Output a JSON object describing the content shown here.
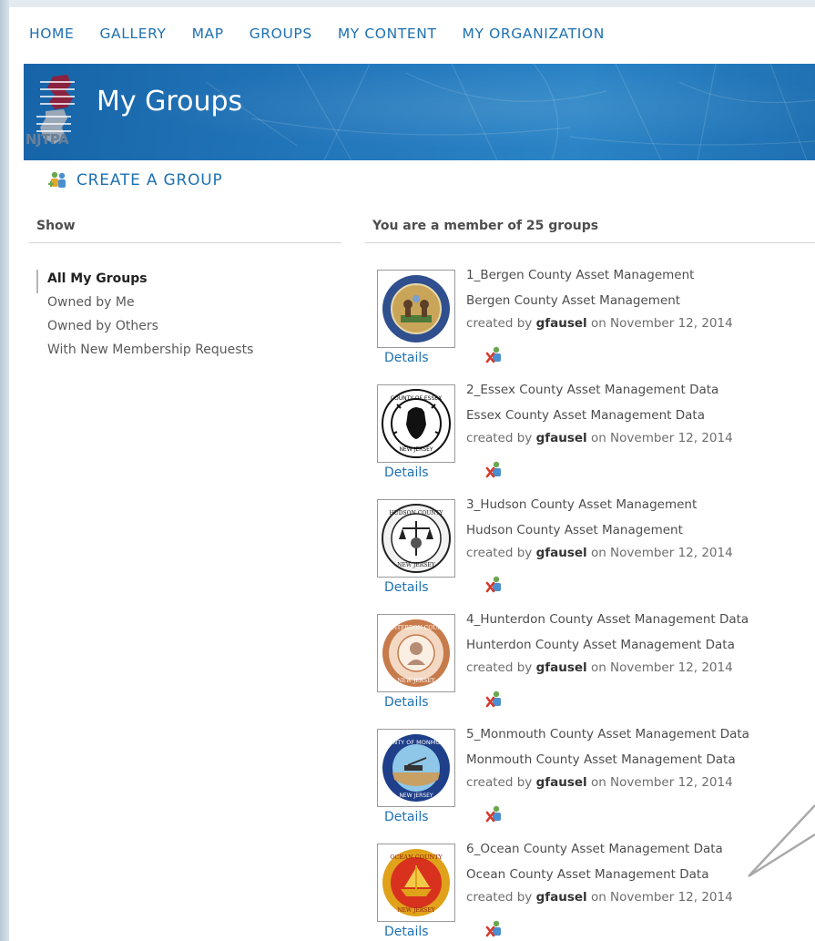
{
  "nav": {
    "items": [
      "HOME",
      "GALLERY",
      "MAP",
      "GROUPS",
      "MY CONTENT",
      "MY ORGANIZATION"
    ]
  },
  "banner": {
    "title": "My Groups",
    "logo_text": "NJTPA"
  },
  "create_group": {
    "label": "CREATE A GROUP",
    "icon": "group-add-icon"
  },
  "sidebar": {
    "heading": "Show",
    "filters": [
      "All My Groups",
      "Owned by Me",
      "Owned by Others",
      "With New Membership Requests"
    ],
    "active_filter": "All My Groups"
  },
  "main": {
    "heading": "You are a member of 25 groups",
    "groups": [
      {
        "title": "1_Bergen County Asset Management",
        "snippet": "Bergen County Asset Management",
        "created_prefix": "created by",
        "owner": "gfausel",
        "created_on": "on November 12, 2014",
        "details_label": "Details",
        "seal": "bergen-county-seal-icon",
        "colors": {
          "ring": "#2f4f8f",
          "inner": "#c9a55a"
        }
      },
      {
        "title": "2_Essex County Asset Management Data",
        "snippet": "Essex County Asset Management Data",
        "created_prefix": "created by",
        "owner": "gfausel",
        "created_on": "on November 12, 2014",
        "details_label": "Details",
        "seal": "essex-county-seal-icon",
        "colors": {
          "ring": "#111111",
          "inner": "#ffffff"
        }
      },
      {
        "title": "3_Hudson County Asset Management",
        "snippet": "Hudson County Asset Management",
        "created_prefix": "created by",
        "owner": "gfausel",
        "created_on": "on November 12, 2014",
        "details_label": "Details",
        "seal": "hudson-county-seal-icon",
        "colors": {
          "ring": "#222222",
          "inner": "#f2f2f2"
        }
      },
      {
        "title": "4_Hunterdon County Asset Management Data",
        "snippet": "Hunterdon County Asset Management Data",
        "created_prefix": "created by",
        "owner": "gfausel",
        "created_on": "on November 12, 2014",
        "details_label": "Details",
        "seal": "hunterdon-county-seal-icon",
        "colors": {
          "ring": "#c77a4a",
          "inner": "#f3d9c4"
        }
      },
      {
        "title": "5_Monmouth County Asset Management Data",
        "snippet": "Monmouth County Asset Management Data",
        "created_prefix": "created by",
        "owner": "gfausel",
        "created_on": "on November 12, 2014",
        "details_label": "Details",
        "seal": "monmouth-county-seal-icon",
        "colors": {
          "ring": "#1f3f8a",
          "inner": "#8fc7e8"
        }
      },
      {
        "title": "6_Ocean County Asset Management Data",
        "snippet": "Ocean County Asset Management Data",
        "created_prefix": "created by",
        "owner": "gfausel",
        "created_on": "on November 12, 2014",
        "details_label": "Details",
        "seal": "ocean-county-seal-icon",
        "colors": {
          "ring": "#e0a21a",
          "inner": "#d8321e"
        }
      }
    ]
  },
  "colors": {
    "link": "#1e71b2",
    "banner": "#2377bb",
    "text": "#4d4d4d",
    "leave_x": "#d63a2c"
  }
}
